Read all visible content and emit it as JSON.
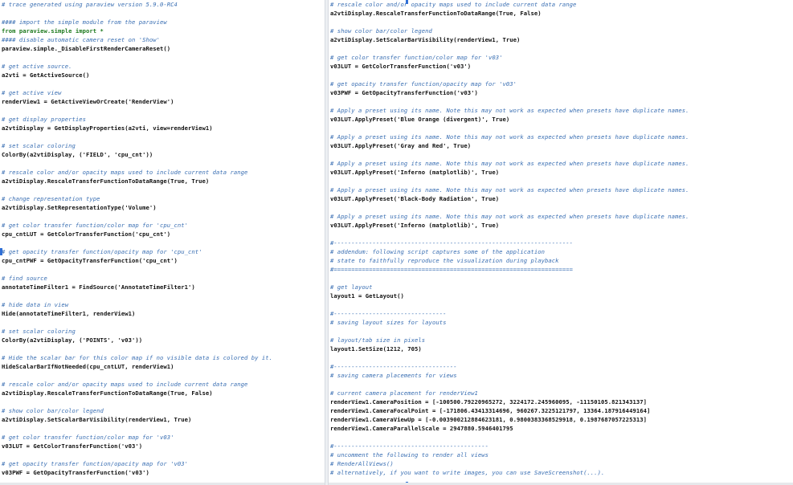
{
  "left_pane": {
    "lines": [
      {
        "text": "# trace generated using paraview version 5.9.0-RC4",
        "kind": "comment"
      },
      {
        "text": "",
        "kind": "blank"
      },
      {
        "text": "#### import the simple module from the paraview",
        "kind": "comment"
      },
      {
        "text": "from paraview.simple import *",
        "kind": "kw"
      },
      {
        "text": "#### disable automatic camera reset on 'Show'",
        "kind": "comment"
      },
      {
        "text": "paraview.simple._DisableFirstRenderCameraReset()",
        "kind": "code"
      },
      {
        "text": "",
        "kind": "blank"
      },
      {
        "text": "# get active source.",
        "kind": "comment"
      },
      {
        "text": "a2vti = GetActiveSource()",
        "kind": "code"
      },
      {
        "text": "",
        "kind": "blank"
      },
      {
        "text": "# get active view",
        "kind": "comment"
      },
      {
        "text": "renderView1 = GetActiveViewOrCreate('RenderView')",
        "kind": "code"
      },
      {
        "text": "",
        "kind": "blank"
      },
      {
        "text": "# get display properties",
        "kind": "comment"
      },
      {
        "text": "a2vtiDisplay = GetDisplayProperties(a2vti, view=renderView1)",
        "kind": "code"
      },
      {
        "text": "",
        "kind": "blank"
      },
      {
        "text": "# set scalar coloring",
        "kind": "comment"
      },
      {
        "text": "ColorBy(a2vtiDisplay, ('FIELD', 'cpu_cnt'))",
        "kind": "code"
      },
      {
        "text": "",
        "kind": "blank"
      },
      {
        "text": "# rescale color and/or opacity maps used to include current data range",
        "kind": "comment"
      },
      {
        "text": "a2vtiDisplay.RescaleTransferFunctionToDataRange(True, True)",
        "kind": "code"
      },
      {
        "text": "",
        "kind": "blank"
      },
      {
        "text": "# change representation type",
        "kind": "comment"
      },
      {
        "text": "a2vtiDisplay.SetRepresentationType('Volume')",
        "kind": "code"
      },
      {
        "text": "",
        "kind": "blank"
      },
      {
        "text": "# get color transfer function/color map for 'cpu_cnt'",
        "kind": "comment"
      },
      {
        "text": "cpu_cntLUT = GetColorTransferFunction('cpu_cnt')",
        "kind": "code"
      },
      {
        "text": "",
        "kind": "blank"
      },
      {
        "text": "# get opacity transfer function/opacity map for 'cpu_cnt'",
        "kind": "comment"
      },
      {
        "text": "cpu_cntPWF = GetOpacityTransferFunction('cpu_cnt')",
        "kind": "code"
      },
      {
        "text": "",
        "kind": "blank"
      },
      {
        "text": "# find source",
        "kind": "comment"
      },
      {
        "text": "annotateTimeFilter1 = FindSource('AnnotateTimeFilter1')",
        "kind": "code"
      },
      {
        "text": "",
        "kind": "blank"
      },
      {
        "text": "# hide data in view",
        "kind": "comment"
      },
      {
        "text": "Hide(annotateTimeFilter1, renderView1)",
        "kind": "code"
      },
      {
        "text": "",
        "kind": "blank"
      },
      {
        "text": "# set scalar coloring",
        "kind": "comment"
      },
      {
        "text": "ColorBy(a2vtiDisplay, ('POINTS', 'v03'))",
        "kind": "code"
      },
      {
        "text": "",
        "kind": "blank"
      },
      {
        "text": "# Hide the scalar bar for this color map if no visible data is colored by it.",
        "kind": "comment"
      },
      {
        "text": "HideScalarBarIfNotNeeded(cpu_cntLUT, renderView1)",
        "kind": "code"
      },
      {
        "text": "",
        "kind": "blank"
      },
      {
        "text": "# rescale color and/or opacity maps used to include current data range",
        "kind": "comment"
      },
      {
        "text": "a2vtiDisplay.RescaleTransferFunctionToDataRange(True, False)",
        "kind": "code"
      },
      {
        "text": "",
        "kind": "blank"
      },
      {
        "text": "# show color bar/color legend",
        "kind": "comment"
      },
      {
        "text": "a2vtiDisplay.SetScalarBarVisibility(renderView1, True)",
        "kind": "code"
      },
      {
        "text": "",
        "kind": "blank"
      },
      {
        "text": "# get color transfer function/color map for 'v03'",
        "kind": "comment"
      },
      {
        "text": "v03LUT = GetColorTransferFunction('v03')",
        "kind": "code"
      },
      {
        "text": "",
        "kind": "blank"
      },
      {
        "text": "# get opacity transfer function/opacity map for 'v03'",
        "kind": "comment"
      },
      {
        "text": "v03PWF = GetOpacityTransferFunction('v03')",
        "kind": "code"
      }
    ]
  },
  "right_pane": {
    "lines": [
      {
        "text": "# rescale color and/or opacity maps used to include current data range",
        "kind": "comment"
      },
      {
        "text": "a2vtiDisplay.RescaleTransferFunctionToDataRange(True, False)",
        "kind": "code"
      },
      {
        "text": "",
        "kind": "blank"
      },
      {
        "text": "# show color bar/color legend",
        "kind": "comment"
      },
      {
        "text": "a2vtiDisplay.SetScalarBarVisibility(renderView1, True)",
        "kind": "code"
      },
      {
        "text": "",
        "kind": "blank"
      },
      {
        "text": "# get color transfer function/color map for 'v03'",
        "kind": "comment"
      },
      {
        "text": "v03LUT = GetColorTransferFunction('v03')",
        "kind": "code"
      },
      {
        "text": "",
        "kind": "blank"
      },
      {
        "text": "# get opacity transfer function/opacity map for 'v03'",
        "kind": "comment"
      },
      {
        "text": "v03PWF = GetOpacityTransferFunction('v03')",
        "kind": "code"
      },
      {
        "text": "",
        "kind": "blank"
      },
      {
        "text": "# Apply a preset using its name. Note this may not work as expected when presets have duplicate names.",
        "kind": "comment"
      },
      {
        "text": "v03LUT.ApplyPreset('Blue Orange (divergent)', True)",
        "kind": "code"
      },
      {
        "text": "",
        "kind": "blank"
      },
      {
        "text": "# Apply a preset using its name. Note this may not work as expected when presets have duplicate names.",
        "kind": "comment"
      },
      {
        "text": "v03LUT.ApplyPreset('Gray and Red', True)",
        "kind": "code"
      },
      {
        "text": "",
        "kind": "blank"
      },
      {
        "text": "# Apply a preset using its name. Note this may not work as expected when presets have duplicate names.",
        "kind": "comment"
      },
      {
        "text": "v03LUT.ApplyPreset('Inferno (matplotlib)', True)",
        "kind": "code"
      },
      {
        "text": "",
        "kind": "blank"
      },
      {
        "text": "# Apply a preset using its name. Note this may not work as expected when presets have duplicate names.",
        "kind": "comment"
      },
      {
        "text": "v03LUT.ApplyPreset('Black-Body Radiation', True)",
        "kind": "code"
      },
      {
        "text": "",
        "kind": "blank"
      },
      {
        "text": "# Apply a preset using its name. Note this may not work as expected when presets have duplicate names.",
        "kind": "comment"
      },
      {
        "text": "v03LUT.ApplyPreset('Inferno (matplotlib)', True)",
        "kind": "code"
      },
      {
        "text": "",
        "kind": "blank"
      },
      {
        "text": "#--------------------------------------------------------------------",
        "kind": "comment"
      },
      {
        "text": "# addendum: following script captures some of the application",
        "kind": "comment"
      },
      {
        "text": "# state to faithfully reproduce the visualization during playback",
        "kind": "comment"
      },
      {
        "text": "#====================================================================",
        "kind": "comment"
      },
      {
        "text": "",
        "kind": "blank"
      },
      {
        "text": "# get layout",
        "kind": "comment"
      },
      {
        "text": "layout1 = GetLayout()",
        "kind": "code"
      },
      {
        "text": "",
        "kind": "blank"
      },
      {
        "text": "#--------------------------------",
        "kind": "comment"
      },
      {
        "text": "# saving layout sizes for layouts",
        "kind": "comment"
      },
      {
        "text": "",
        "kind": "blank"
      },
      {
        "text": "# layout/tab size in pixels",
        "kind": "comment"
      },
      {
        "text": "layout1.SetSize(1212, 705)",
        "kind": "code"
      },
      {
        "text": "",
        "kind": "blank"
      },
      {
        "text": "#-----------------------------------",
        "kind": "comment"
      },
      {
        "text": "# saving camera placements for views",
        "kind": "comment"
      },
      {
        "text": "",
        "kind": "blank"
      },
      {
        "text": "# current camera placement for renderView1",
        "kind": "comment"
      },
      {
        "text": "renderView1.CameraPosition = [-100500.79220965272, 3224172.245960095, -11150105.821343137]",
        "kind": "code"
      },
      {
        "text": "renderView1.CameraFocalPoint = [-171806.43413314696, 960267.3225121797, 13364.187916449164]",
        "kind": "code"
      },
      {
        "text": "renderView1.CameraViewUp = [-0.003900212884623181, 0.9800383368529918, 0.1987687057225313]",
        "kind": "code"
      },
      {
        "text": "renderView1.CameraParallelScale = 2947880.5946401795",
        "kind": "code"
      },
      {
        "text": "",
        "kind": "blank"
      },
      {
        "text": "#--------------------------------------------",
        "kind": "comment"
      },
      {
        "text": "# uncomment the following to render all views",
        "kind": "comment"
      },
      {
        "text": "# RenderAllViews()",
        "kind": "comment"
      },
      {
        "text": "# alternatively, if you want to write images, you can use SaveScreenshot(...).",
        "kind": "comment"
      }
    ]
  }
}
